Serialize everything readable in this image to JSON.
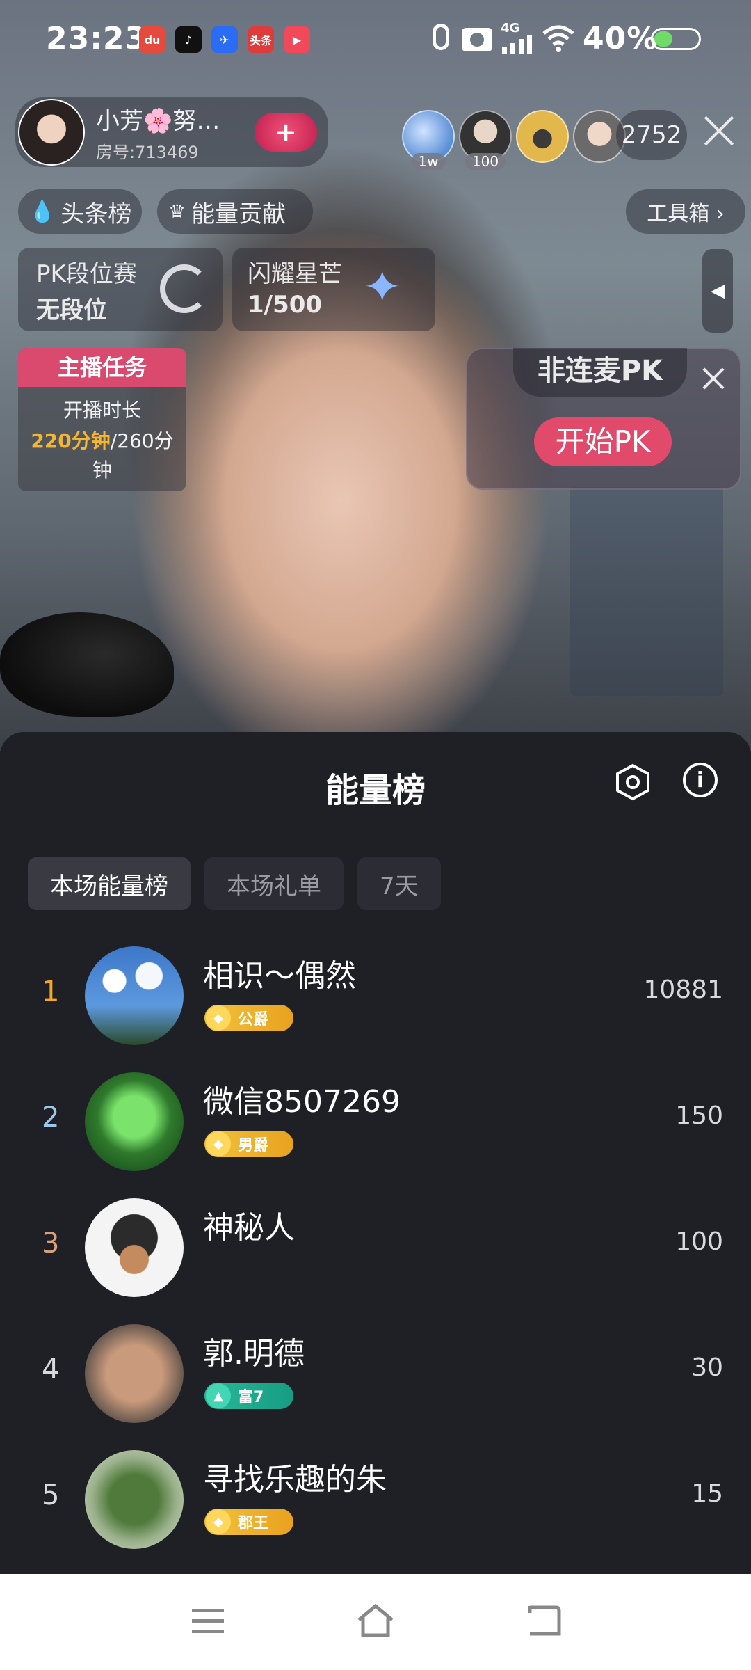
{
  "status_bar": {
    "time": "23:23",
    "apps": [
      {
        "icon": "baidu-app-icon",
        "label": "du",
        "color": "#e64a3d"
      },
      {
        "icon": "douyin-app-icon",
        "label": "♪",
        "color": "#111111"
      },
      {
        "icon": "feishu-app-icon",
        "label": "✈",
        "color": "#2a6df4"
      },
      {
        "icon": "toutiao-app-icon",
        "label": "头条",
        "color": "#e03b3b"
      },
      {
        "icon": "video-app-icon",
        "label": "▶",
        "color": "#f04a5a"
      }
    ],
    "network": "4G",
    "battery": "40%"
  },
  "host": {
    "name": "小芳🌸努…",
    "room": "房号:713469",
    "follow_icon": "plus-icon"
  },
  "viewers": [
    {
      "badge": "1w"
    },
    {
      "badge": "100"
    },
    {
      "badge": ""
    },
    {
      "badge": ""
    }
  ],
  "viewer_count": "2752",
  "rank_chips": {
    "headline": "头条榜",
    "energy": "能量贡献",
    "toolbox": "工具箱 ›"
  },
  "pk_rank": {
    "title": "PK段位赛",
    "value": "无段位"
  },
  "star": {
    "title": "闪耀星芒",
    "value": "1/500"
  },
  "host_task": {
    "title": "主播任务",
    "line1": "开播时长",
    "progress": "220分钟",
    "total": "/260分",
    "unit": "钟"
  },
  "pk_card": {
    "title": "非连麦PK",
    "button": "开始PK"
  },
  "sheet": {
    "title": "能量榜",
    "tabs": [
      "本场能量榜",
      "本场礼单",
      "7天"
    ],
    "active_tab": 0,
    "rows": [
      {
        "rank": "1",
        "rank_color": "#f5a623",
        "name": "相识～偶然",
        "badge": "公爵",
        "badge_type": "gold",
        "score": "10881",
        "avatar": "sky"
      },
      {
        "rank": "2",
        "rank_color": "#9cc7e8",
        "name": "微信8507269",
        "badge": "男爵",
        "badge_type": "gold",
        "score": "150",
        "avatar": "clover"
      },
      {
        "rank": "3",
        "rank_color": "#d9a27c",
        "name": "神秘人",
        "badge": "",
        "badge_type": "none",
        "score": "100",
        "avatar": "mystery"
      },
      {
        "rank": "4",
        "rank_color": "#d8d8de",
        "name": "郭.明德",
        "badge": "富7",
        "badge_type": "teal",
        "score": "30",
        "avatar": "face"
      },
      {
        "rank": "5",
        "rank_color": "#d8d8de",
        "name": "寻找乐趣的朱",
        "badge": "郡王",
        "badge_type": "gold",
        "score": "15",
        "avatar": "plant"
      }
    ]
  },
  "nav": {
    "menu_icon": "menu-icon",
    "home_icon": "home-icon",
    "back_icon": "back-icon"
  }
}
